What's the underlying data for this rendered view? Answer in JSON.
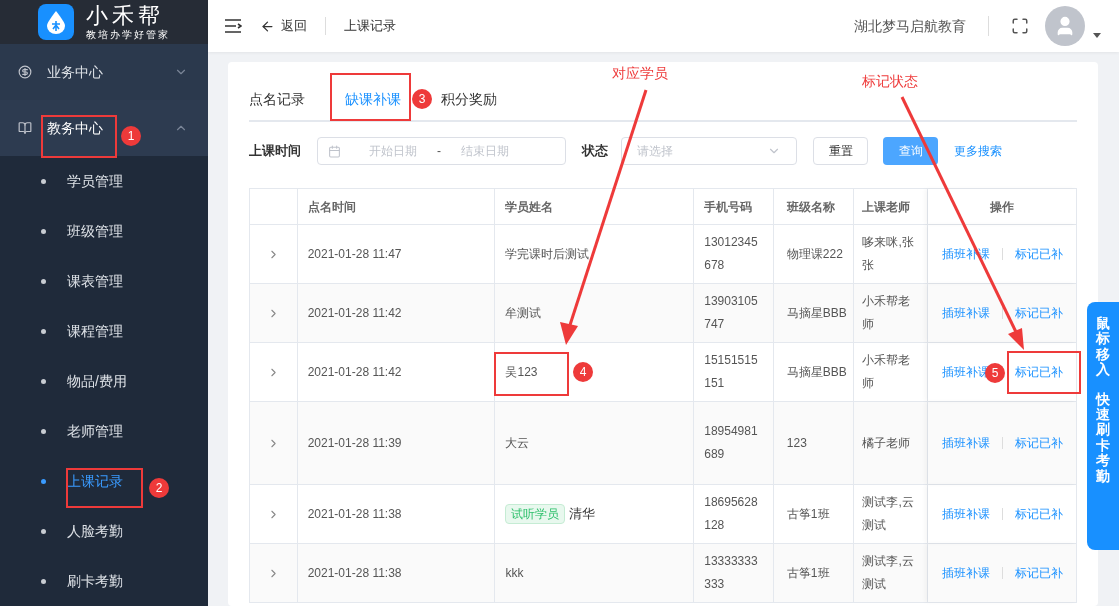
{
  "sidebar": {
    "logo": {
      "name": "小禾帮",
      "slogan": "教培办学好管家"
    },
    "groups": [
      {
        "label": "业务中心",
        "expanded": false
      },
      {
        "label": "教务中心",
        "expanded": true,
        "children": [
          {
            "label": "学员管理",
            "selected": false
          },
          {
            "label": "班级管理",
            "selected": false
          },
          {
            "label": "课表管理",
            "selected": false
          },
          {
            "label": "课程管理",
            "selected": false
          },
          {
            "label": "物品/费用",
            "selected": false
          },
          {
            "label": "老师管理",
            "selected": false
          },
          {
            "label": "上课记录",
            "selected": true
          },
          {
            "label": "人脸考勤",
            "selected": false
          },
          {
            "label": "刷卡考勤",
            "selected": false
          }
        ]
      }
    ]
  },
  "header": {
    "back": "返回",
    "page_title": "上课记录",
    "org": "湖北梦马启航教育"
  },
  "tabs": [
    {
      "label": "点名记录",
      "selected": false
    },
    {
      "label": "缺课补课",
      "selected": true
    },
    {
      "label": "积分奖励",
      "selected": false
    }
  ],
  "filters": {
    "date_label": "上课时间",
    "start_placeholder": "开始日期",
    "separator": "-",
    "end_placeholder": "结束日期",
    "status_label": "状态",
    "status_placeholder": "请选择",
    "reset": "重置",
    "search": "查询",
    "more": "更多搜索"
  },
  "table": {
    "columns": [
      "点名时间",
      "学员姓名",
      "手机号码",
      "班级名称",
      "上课老师",
      "操作"
    ],
    "rows": [
      {
        "time": "2021-01-28 11:47",
        "student": "学完课时后测试",
        "phone": "13012345678",
        "class": "物理课222",
        "teacher": "哆来咪,张张",
        "actions": [
          "插班补课",
          "标记已补"
        ]
      },
      {
        "time": "2021-01-28 11:42",
        "student": "牟测试",
        "phone": "13903105747",
        "class": "马摘星BBB",
        "teacher": "小禾帮老师",
        "actions": [
          "插班补课",
          "标记已补"
        ]
      },
      {
        "time": "2021-01-28 11:42",
        "student": "吴123",
        "phone": "15151515151",
        "class": "马摘星BBB",
        "teacher": "小禾帮老师",
        "actions": [
          "插班补课",
          "标记已补"
        ]
      },
      {
        "time": "2021-01-28 11:39",
        "student": "大云",
        "phone": "18954981689",
        "class": "123",
        "teacher": "橘子老师",
        "actions": [
          "插班补课",
          "标记已补"
        ]
      },
      {
        "time": "2021-01-28 11:38",
        "tag": "试听学员",
        "student": "清华",
        "phone": "18695628128",
        "class": "古筝1班",
        "teacher": "测试李,云测试",
        "actions": [
          "插班补课",
          "标记已补"
        ]
      },
      {
        "time": "2021-01-28 11:38",
        "student": "kkk",
        "phone": "13333333333",
        "class": "古筝1班",
        "teacher": "测试李,云测试",
        "actions": [
          "插班补课",
          "标记已补"
        ]
      }
    ]
  },
  "side_tab": [
    "鼠标移入",
    "快速刷卡考勤"
  ],
  "annotations": {
    "callouts": [
      "1",
      "2",
      "3",
      "4",
      "5"
    ],
    "labels": [
      "对应学员",
      "标记状态"
    ]
  }
}
